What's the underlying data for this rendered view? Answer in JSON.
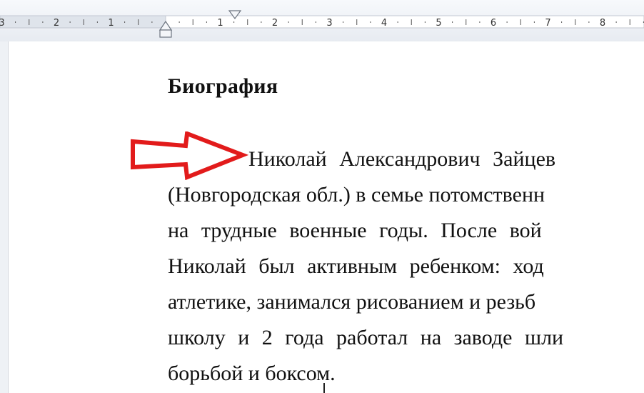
{
  "ruler": {
    "labels_left": [
      "3",
      "2",
      "1"
    ],
    "labels_right": [
      "1",
      "2",
      "3",
      "4",
      "5",
      "6",
      "7",
      "8"
    ]
  },
  "document": {
    "heading": "Биография",
    "paragraph_lines": [
      "Николай Александрович Зайцев",
      "(Новгородская обл.) в семье потомственн",
      "на трудные военные годы. После вой",
      "Николай был активным ребенком: ход",
      "атлетике, занимался рисованием и резьб",
      "школу и 2 года работал на заводе шли",
      "борьбой и боксом."
    ]
  },
  "annotation": {
    "arrow_color": "#e21b1b",
    "arrow_icon": "right-arrow-outline-icon"
  },
  "colors": {
    "ruler_bg": "#eef1f6",
    "page_bg": "#ffffff",
    "text": "#111111"
  }
}
